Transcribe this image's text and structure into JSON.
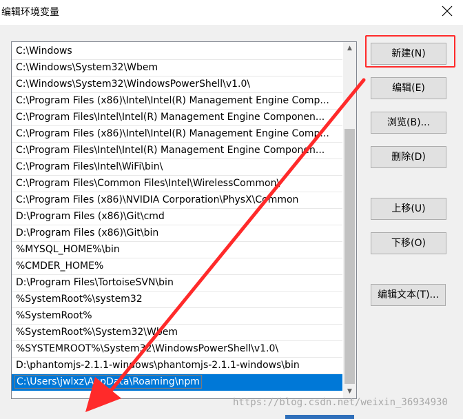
{
  "window": {
    "title": "编辑环境变量",
    "close_icon": "close-icon"
  },
  "paths": [
    "C:\\Windows",
    "C:\\Windows\\System32\\Wbem",
    "C:\\Windows\\System32\\WindowsPowerShell\\v1.0\\",
    "C:\\Program Files (x86)\\Intel\\Intel(R) Management Engine Comp...",
    "C:\\Program Files\\Intel\\Intel(R) Management Engine Componen...",
    "C:\\Program Files (x86)\\Intel\\Intel(R) Management Engine Comp...",
    "C:\\Program Files\\Intel\\Intel(R) Management Engine Componen...",
    "C:\\Program Files\\Intel\\WiFi\\bin\\",
    "C:\\Program Files\\Common Files\\Intel\\WirelessCommon\\",
    "C:\\Program Files (x86)\\NVIDIA Corporation\\PhysX\\Common",
    "D:\\Program Files (x86)\\Git\\cmd",
    "D:\\Program Files (x86)\\Git\\bin",
    "%MYSQL_HOME%\\bin",
    "%CMDER_HOME%",
    "D:\\Program Files\\TortoiseSVN\\bin",
    "%SystemRoot%\\system32",
    "%SystemRoot%",
    "%SystemRoot%\\System32\\Wbem",
    "%SYSTEMROOT%\\System32\\WindowsPowerShell\\v1.0\\",
    "D:\\phantomjs-2.1.1-windows\\phantomjs-2.1.1-windows\\bin"
  ],
  "editing_value": "C:\\Users\\jwlxz\\AppData\\Roaming\\npm",
  "buttons": {
    "new": "新建(N)",
    "edit": "编辑(E)",
    "browse": "浏览(B)...",
    "delete": "删除(D)",
    "move_up": "上移(U)",
    "move_down": "下移(O)",
    "edit_text": "编辑文本(T)..."
  },
  "colors": {
    "selection": "#0078d7",
    "annotation": "#ff2a2a"
  },
  "watermark": "https://blog.csdn.net/weixin_36934930"
}
